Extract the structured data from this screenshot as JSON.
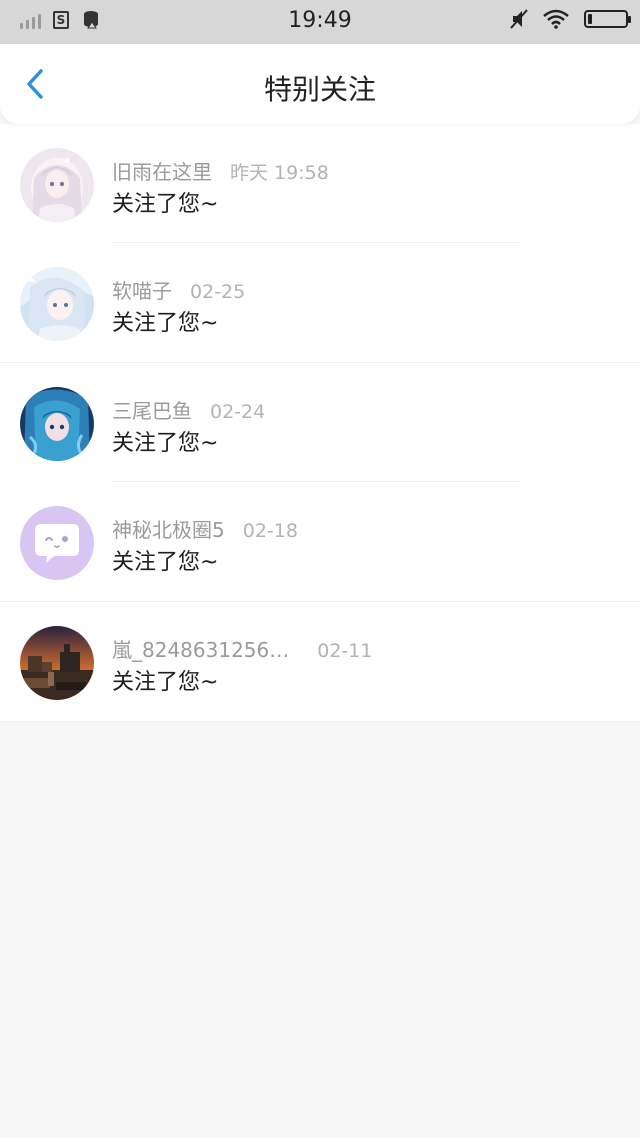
{
  "status_bar": {
    "time": "19:49",
    "sim_label": "S"
  },
  "header": {
    "title": "特别关注"
  },
  "notifications": [
    {
      "name": "旧雨在这里",
      "time": "昨天 19:58",
      "message": "关注了您~",
      "avatar_icon": "anime-girl-white-hair"
    },
    {
      "name": "软喵子",
      "time": "02-25",
      "message": "关注了您~",
      "avatar_icon": "anime-girl-blue-sky"
    },
    {
      "name": "三尾巴鱼",
      "time": "02-24",
      "message": "关注了您~",
      "avatar_icon": "anime-girl-blue-hair"
    },
    {
      "name": "神秘北极圈5",
      "time": "02-18",
      "message": "关注了您~",
      "avatar_icon": "chat-bubble-face",
      "avatar_color": "#d9c5f2"
    },
    {
      "name": "嵐_8248631256…",
      "time": "02-11",
      "message": "关注了您~",
      "avatar_icon": "minecraft-sunset-scene"
    }
  ],
  "colors": {
    "accent": "#2f8fe0",
    "page_bg": "#f6f6f6",
    "status_bar_bg": "#d7d7d7"
  }
}
